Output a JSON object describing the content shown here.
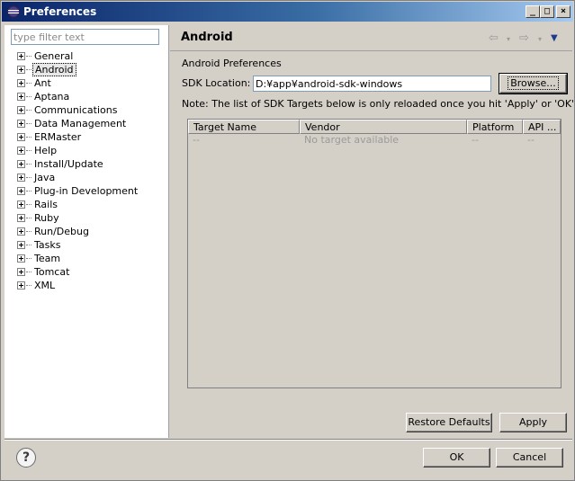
{
  "window": {
    "title": "Preferences",
    "icon": "eclipse-icon"
  },
  "titlebar_buttons": {
    "minimize": "_",
    "maximize": "□",
    "close": "×"
  },
  "filter": {
    "placeholder": "type filter text",
    "value": ""
  },
  "tree": {
    "items": [
      {
        "label": "General"
      },
      {
        "label": "Android",
        "selected": true
      },
      {
        "label": "Ant"
      },
      {
        "label": "Aptana"
      },
      {
        "label": "Communications"
      },
      {
        "label": "Data Management"
      },
      {
        "label": "ERMaster"
      },
      {
        "label": "Help"
      },
      {
        "label": "Install/Update"
      },
      {
        "label": "Java"
      },
      {
        "label": "Plug-in Development"
      },
      {
        "label": "Rails"
      },
      {
        "label": "Ruby"
      },
      {
        "label": "Run/Debug"
      },
      {
        "label": "Tasks"
      },
      {
        "label": "Team"
      },
      {
        "label": "Tomcat"
      },
      {
        "label": "XML"
      }
    ]
  },
  "page": {
    "title": "Android",
    "nav": {
      "back": "⇦",
      "forward": "⇨",
      "dropdown": "▾",
      "menu": "▼"
    },
    "section_label": "Android Preferences",
    "sdk": {
      "label": "SDK Location:",
      "value": "D:¥app¥android-sdk-windows",
      "browse_label": "Browse..."
    },
    "note": "Note: The list of SDK Targets below is only reloaded once you hit 'Apply' or 'OK'.",
    "table": {
      "columns": [
        "Target Name",
        "Vendor",
        "Platform",
        "API ..."
      ],
      "rows": [
        [
          "--",
          "No target available",
          "--",
          "--"
        ]
      ]
    },
    "restore_defaults_label": "Restore Defaults",
    "apply_label": "Apply"
  },
  "footer": {
    "help": "?",
    "ok_label": "OK",
    "cancel_label": "Cancel"
  }
}
